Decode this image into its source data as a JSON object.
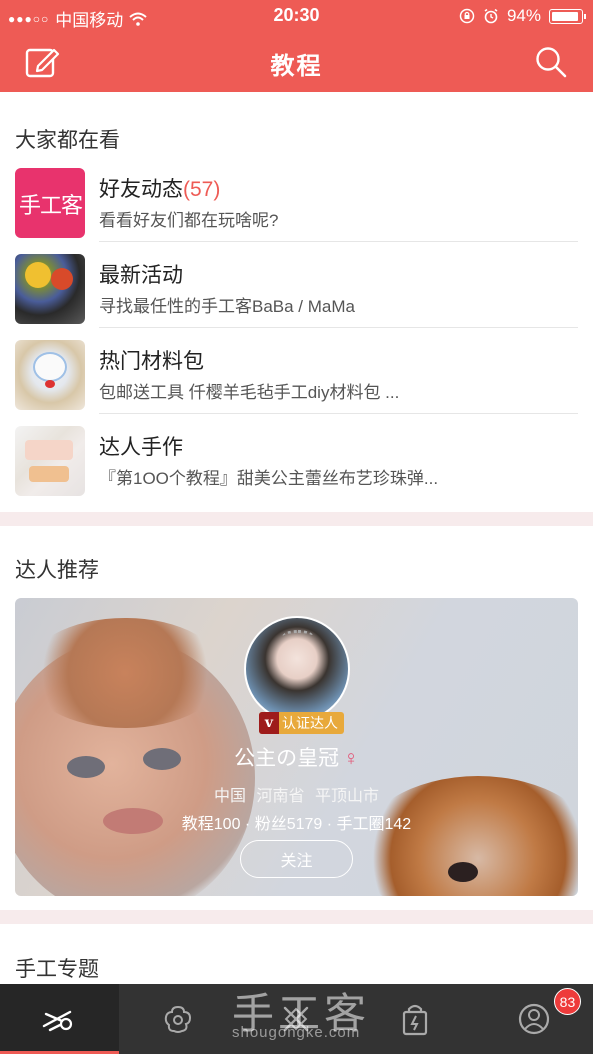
{
  "status_bar": {
    "signal": "●●●○○",
    "carrier": "中国移动",
    "time": "20:30",
    "battery": "94%"
  },
  "header": {
    "title": "教程",
    "left_icon": "edit-icon",
    "right_icon": "search-icon",
    "background_color": "#ee5b55"
  },
  "section_watching": {
    "title": "大家都在看",
    "items": [
      {
        "title": "好友动态",
        "count": "(57)",
        "subtitle": "看看好友们都在玩啥呢?",
        "thumb_text": "手工客"
      },
      {
        "title": "最新活动",
        "count": "",
        "subtitle": "寻找最任性的手工客BaBa / MaMa"
      },
      {
        "title": "热门材料包",
        "count": "",
        "subtitle": "包邮送工具 仟樱羊毛毡手工diy材料包 ..."
      },
      {
        "title": "达人手作",
        "count": "",
        "subtitle": "『第1OO个教程』甜美公主蕾丝布艺珍珠弹..."
      }
    ]
  },
  "section_experts": {
    "title": "达人推荐",
    "card": {
      "badge_v": "v",
      "badge_label": "认证达人",
      "name": "公主の皇冠",
      "gender_symbol": "♀",
      "location": "中国  河南省    平顶山市",
      "stats": "教程100 · 粉丝5179 · 手工圈142",
      "follow_label": "关注"
    }
  },
  "section_topics": {
    "title": "手工专题"
  },
  "tab_bar": {
    "tabs": [
      {
        "icon": "scissors-icon",
        "active": true
      },
      {
        "icon": "flower-icon",
        "active": false
      },
      {
        "icon": "tools-icon",
        "active": false
      },
      {
        "icon": "shopping-bag-icon",
        "active": false
      },
      {
        "icon": "profile-icon",
        "active": false,
        "badge": "83"
      }
    ],
    "watermark": "手工客",
    "watermark_sub": "shougongke.com"
  }
}
